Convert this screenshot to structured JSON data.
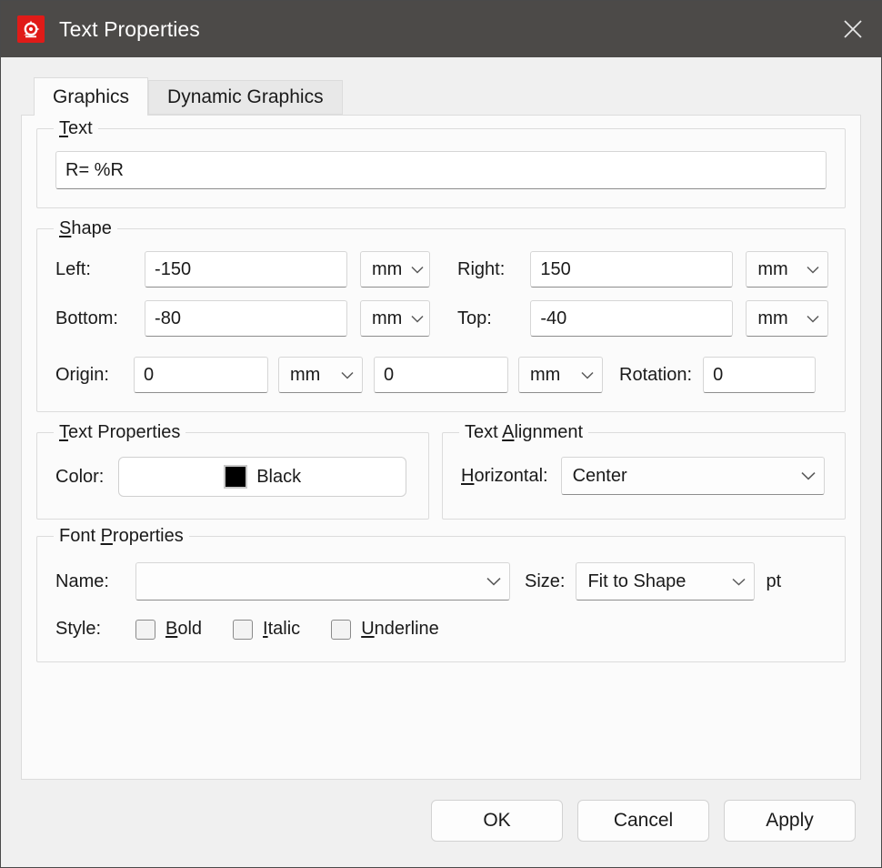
{
  "window": {
    "title": "Text Properties",
    "icon": "app-icon",
    "close_icon": "close-icon",
    "titlebar_color": "#4c4a48",
    "icon_color": "#e01b18"
  },
  "tabs": [
    {
      "label": "Graphics",
      "active": true
    },
    {
      "label": "Dynamic Graphics",
      "active": false
    }
  ],
  "groups": {
    "text": {
      "legend_pre": "",
      "legend_acc": "T",
      "legend_post": "ext",
      "value": "R= %R"
    },
    "shape": {
      "legend_acc": "S",
      "legend_post": "hape",
      "left_label": "Left:",
      "left_value": "-150",
      "left_unit": "mm",
      "right_label": "Right:",
      "right_value": "150",
      "right_unit": "mm",
      "bottom_label": "Bottom:",
      "bottom_value": "-80",
      "bottom_unit": "mm",
      "top_label": "Top:",
      "top_value": "-40",
      "top_unit": "mm",
      "origin_label": "Origin:",
      "origin_x": "0",
      "origin_x_unit": "mm",
      "origin_y": "0",
      "origin_y_unit": "mm",
      "rotation_label": "Rotation:",
      "rotation_value": "0"
    },
    "text_properties": {
      "legend_acc": "T",
      "legend_post": "ext Properties",
      "color_label": "Color:",
      "color_name": "Black",
      "color_hex": "#000000"
    },
    "text_alignment": {
      "legend_pre": "Text ",
      "legend_acc": "A",
      "legend_post": "lignment",
      "horizontal_label_acc": "H",
      "horizontal_label_post": "orizontal:",
      "horizontal_value": "Center"
    },
    "font_properties": {
      "legend_pre": "Font ",
      "legend_acc": "P",
      "legend_post": "roperties",
      "name_label": "Name:",
      "name_value": "",
      "size_label": "Size:",
      "size_value": "Fit to Shape",
      "size_unit": "pt",
      "style_label": "Style:",
      "styles": [
        {
          "acc": "B",
          "post": "old",
          "checked": false
        },
        {
          "acc": "I",
          "post": "talic",
          "checked": false
        },
        {
          "acc": "U",
          "post": "nderline",
          "checked": false
        }
      ]
    }
  },
  "footer": {
    "ok": "OK",
    "cancel": "Cancel",
    "apply": "Apply"
  }
}
